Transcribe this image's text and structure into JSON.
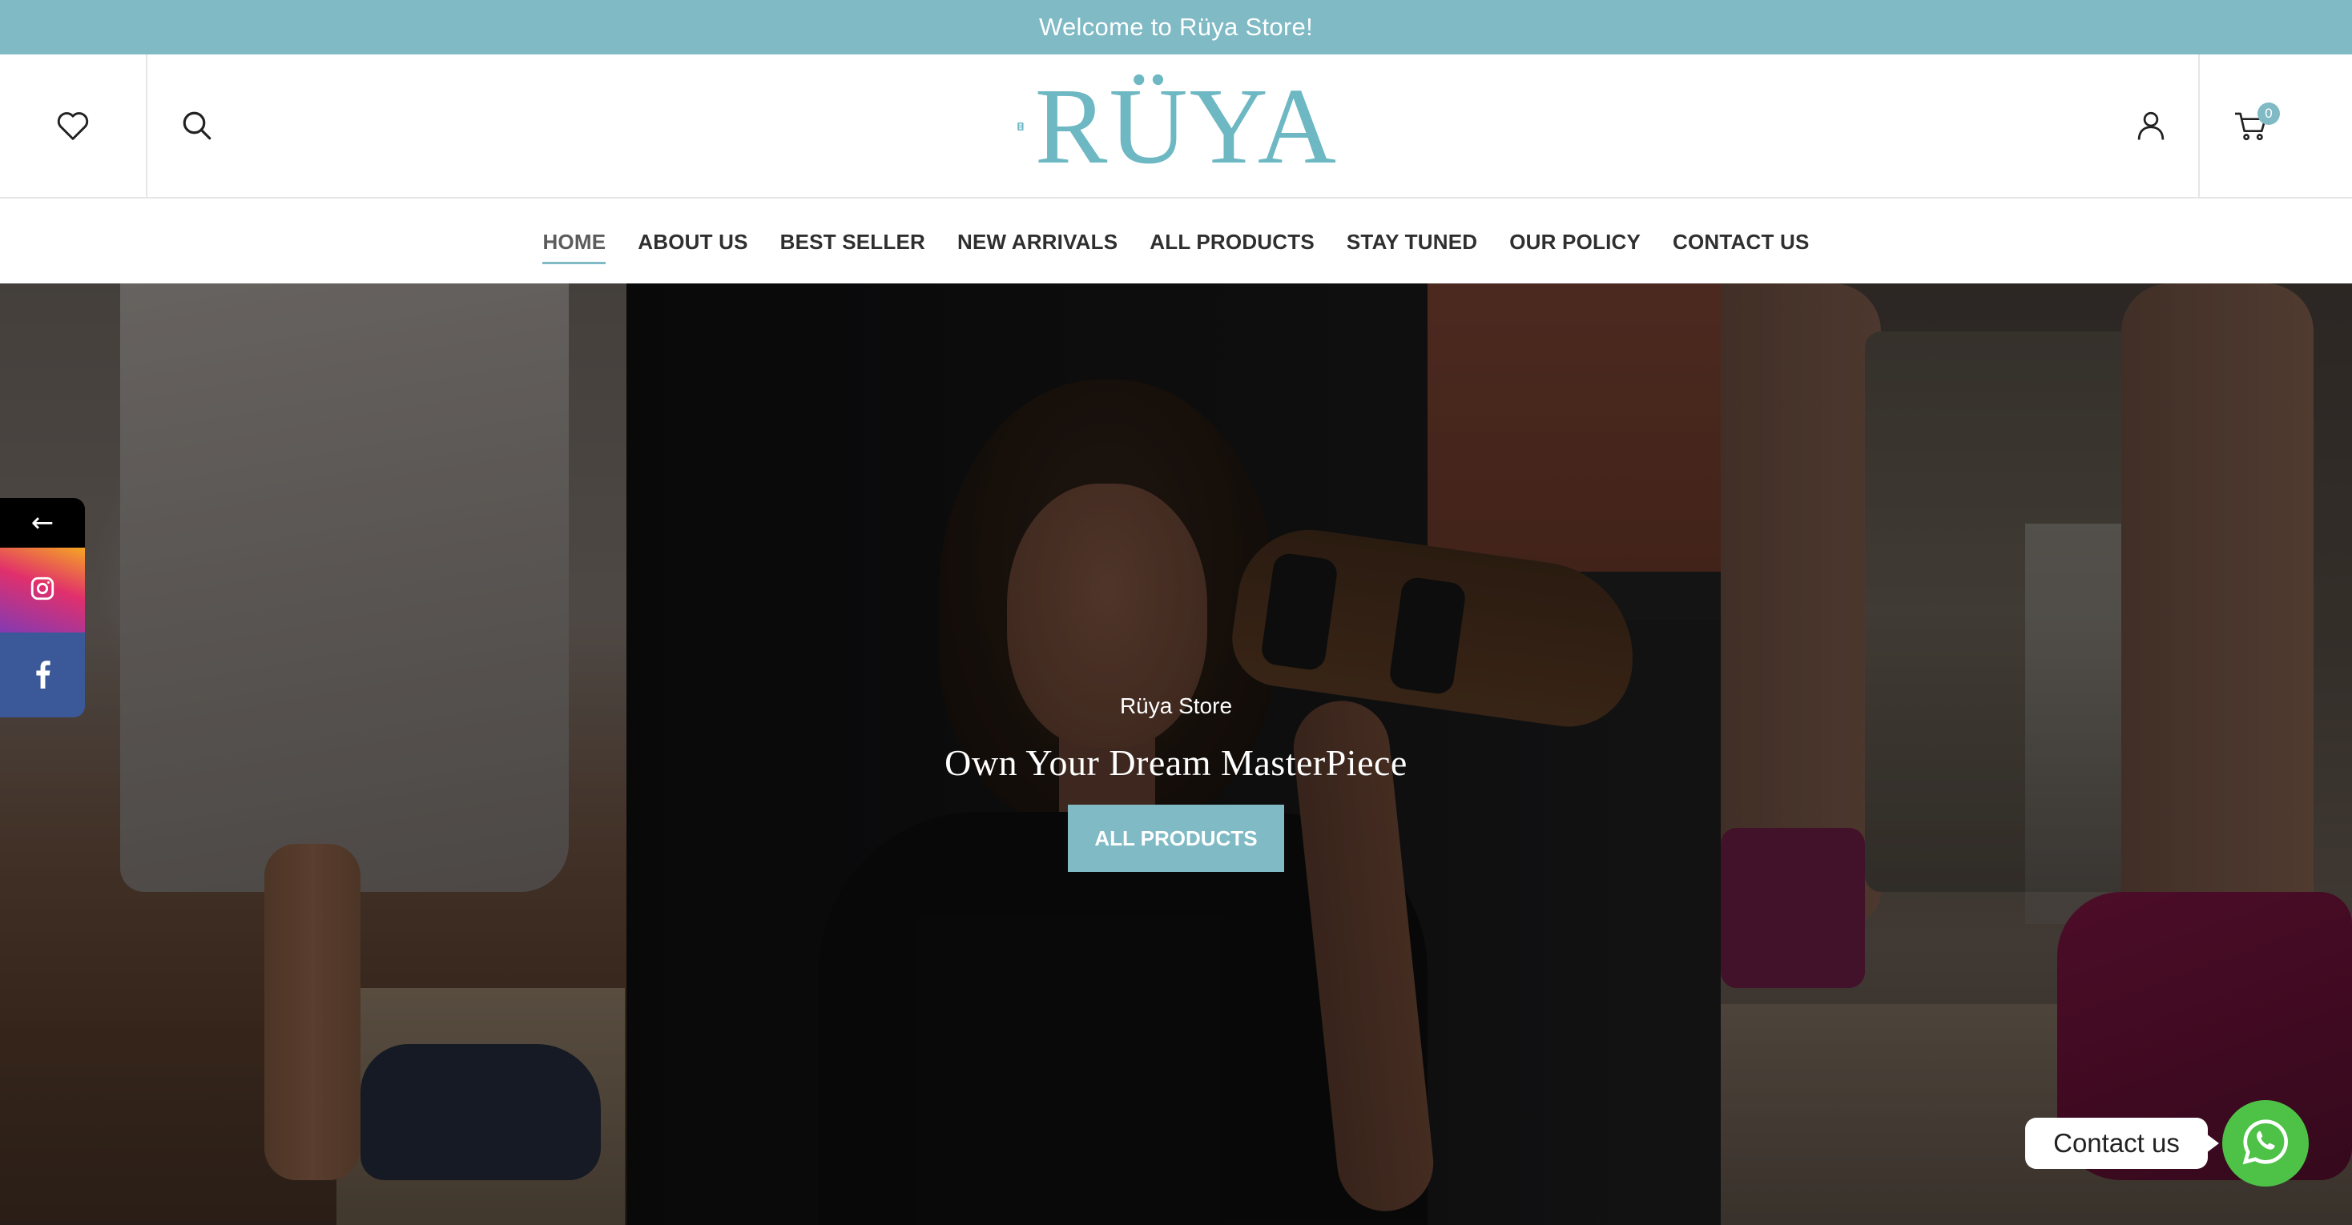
{
  "topbar": {
    "text": "Welcome to Rüya Store!"
  },
  "header": {
    "logo_text": "RÜYA",
    "cart_count": "0"
  },
  "nav": {
    "items": [
      {
        "label": "HOME",
        "active": true
      },
      {
        "label": "ABOUT US"
      },
      {
        "label": "BEST SELLER"
      },
      {
        "label": "NEW ARRIVALS"
      },
      {
        "label": "ALL PRODUCTS"
      },
      {
        "label": "STAY TUNED"
      },
      {
        "label": "OUR POLICY"
      },
      {
        "label": "CONTACT US"
      }
    ]
  },
  "hero": {
    "subtitle": "Rüya Store",
    "title": "Own Your Dream MasterPiece",
    "button_label": "ALL PRODUCTS"
  },
  "social": {
    "toggle_symbol": "←",
    "icons": [
      "instagram-icon",
      "facebook-icon"
    ]
  },
  "contact_widget": {
    "label": "Contact us",
    "icon": "whatsapp-icon"
  },
  "colors": {
    "accent": "#7fbac5",
    "logo": "#6db8c3",
    "whatsapp": "#4dc247",
    "facebook": "#3b5998"
  }
}
